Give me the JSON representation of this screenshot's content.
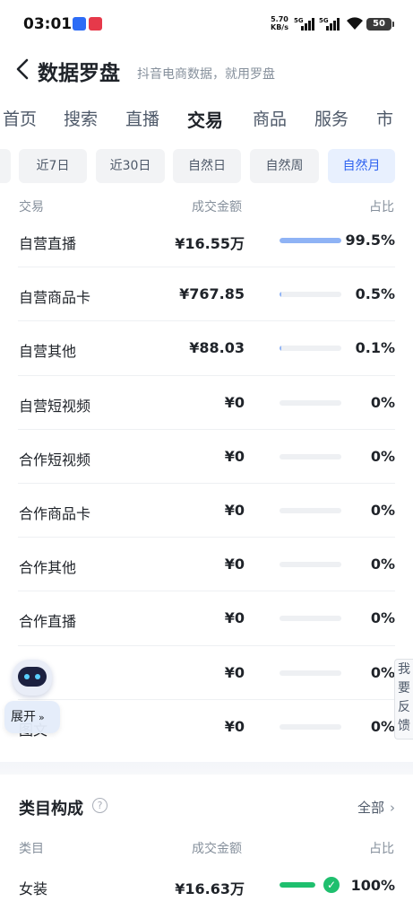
{
  "status_bar": {
    "time": "03:01",
    "speed_value": "5.70",
    "speed_unit": "KB/s",
    "signal_label_1": "5G",
    "signal_label_2": "5G",
    "battery": "50"
  },
  "header": {
    "title": "数据罗盘",
    "subtitle": "抖音电商数据，就用罗盘"
  },
  "tabs": [
    {
      "label": "首页",
      "active": false
    },
    {
      "label": "搜索",
      "active": false
    },
    {
      "label": "直播",
      "active": false
    },
    {
      "label": "交易",
      "active": true
    },
    {
      "label": "商品",
      "active": false
    },
    {
      "label": "服务",
      "active": false
    },
    {
      "label": "市",
      "active": false
    }
  ],
  "periods": [
    {
      "label": "近7日",
      "active": false
    },
    {
      "label": "近30日",
      "active": false
    },
    {
      "label": "自然日",
      "active": false
    },
    {
      "label": "自然周",
      "active": false
    },
    {
      "label": "自然月",
      "active": true
    }
  ],
  "trade_table": {
    "headers": {
      "col1": "交易",
      "col2": "成交金额",
      "col3": "占比"
    },
    "rows": [
      {
        "name": "自营直播",
        "amount": "¥16.55万",
        "share": "99.5%",
        "fill": 0.995
      },
      {
        "name": "自营商品卡",
        "amount": "¥767.85",
        "share": "0.5%",
        "fill": 0.005
      },
      {
        "name": "自营其他",
        "amount": "¥88.03",
        "share": "0.1%",
        "fill": 0.001
      },
      {
        "name": "自营短视频",
        "amount": "¥0",
        "share": "0%",
        "fill": 0
      },
      {
        "name": "合作短视频",
        "amount": "¥0",
        "share": "0%",
        "fill": 0
      },
      {
        "name": "合作商品卡",
        "amount": "¥0",
        "share": "0%",
        "fill": 0
      },
      {
        "name": "合作其他",
        "amount": "¥0",
        "share": "0%",
        "fill": 0
      },
      {
        "name": "合作直播",
        "amount": "¥0",
        "share": "0%",
        "fill": 0
      },
      {
        "name": "图文",
        "amount": "¥0",
        "share": "0%",
        "fill": 0
      },
      {
        "name": "图文",
        "amount": "¥0",
        "share": "0%",
        "fill": 0
      }
    ]
  },
  "assistant": {
    "expand_label": "展开"
  },
  "feedback": {
    "label": "我要反馈"
  },
  "category": {
    "title": "类目构成",
    "all_label": "全部",
    "headers": {
      "col1": "类目",
      "col2": "成交金额",
      "col3": "占比"
    },
    "rows": [
      {
        "name": "女装",
        "amount": "¥16.63万",
        "share": "100%",
        "fill": 1.0
      }
    ]
  },
  "colors": {
    "accent_blue": "#2f63f0",
    "bar_blue": "#8fb3f5",
    "bar_green": "#1fbf6e"
  }
}
